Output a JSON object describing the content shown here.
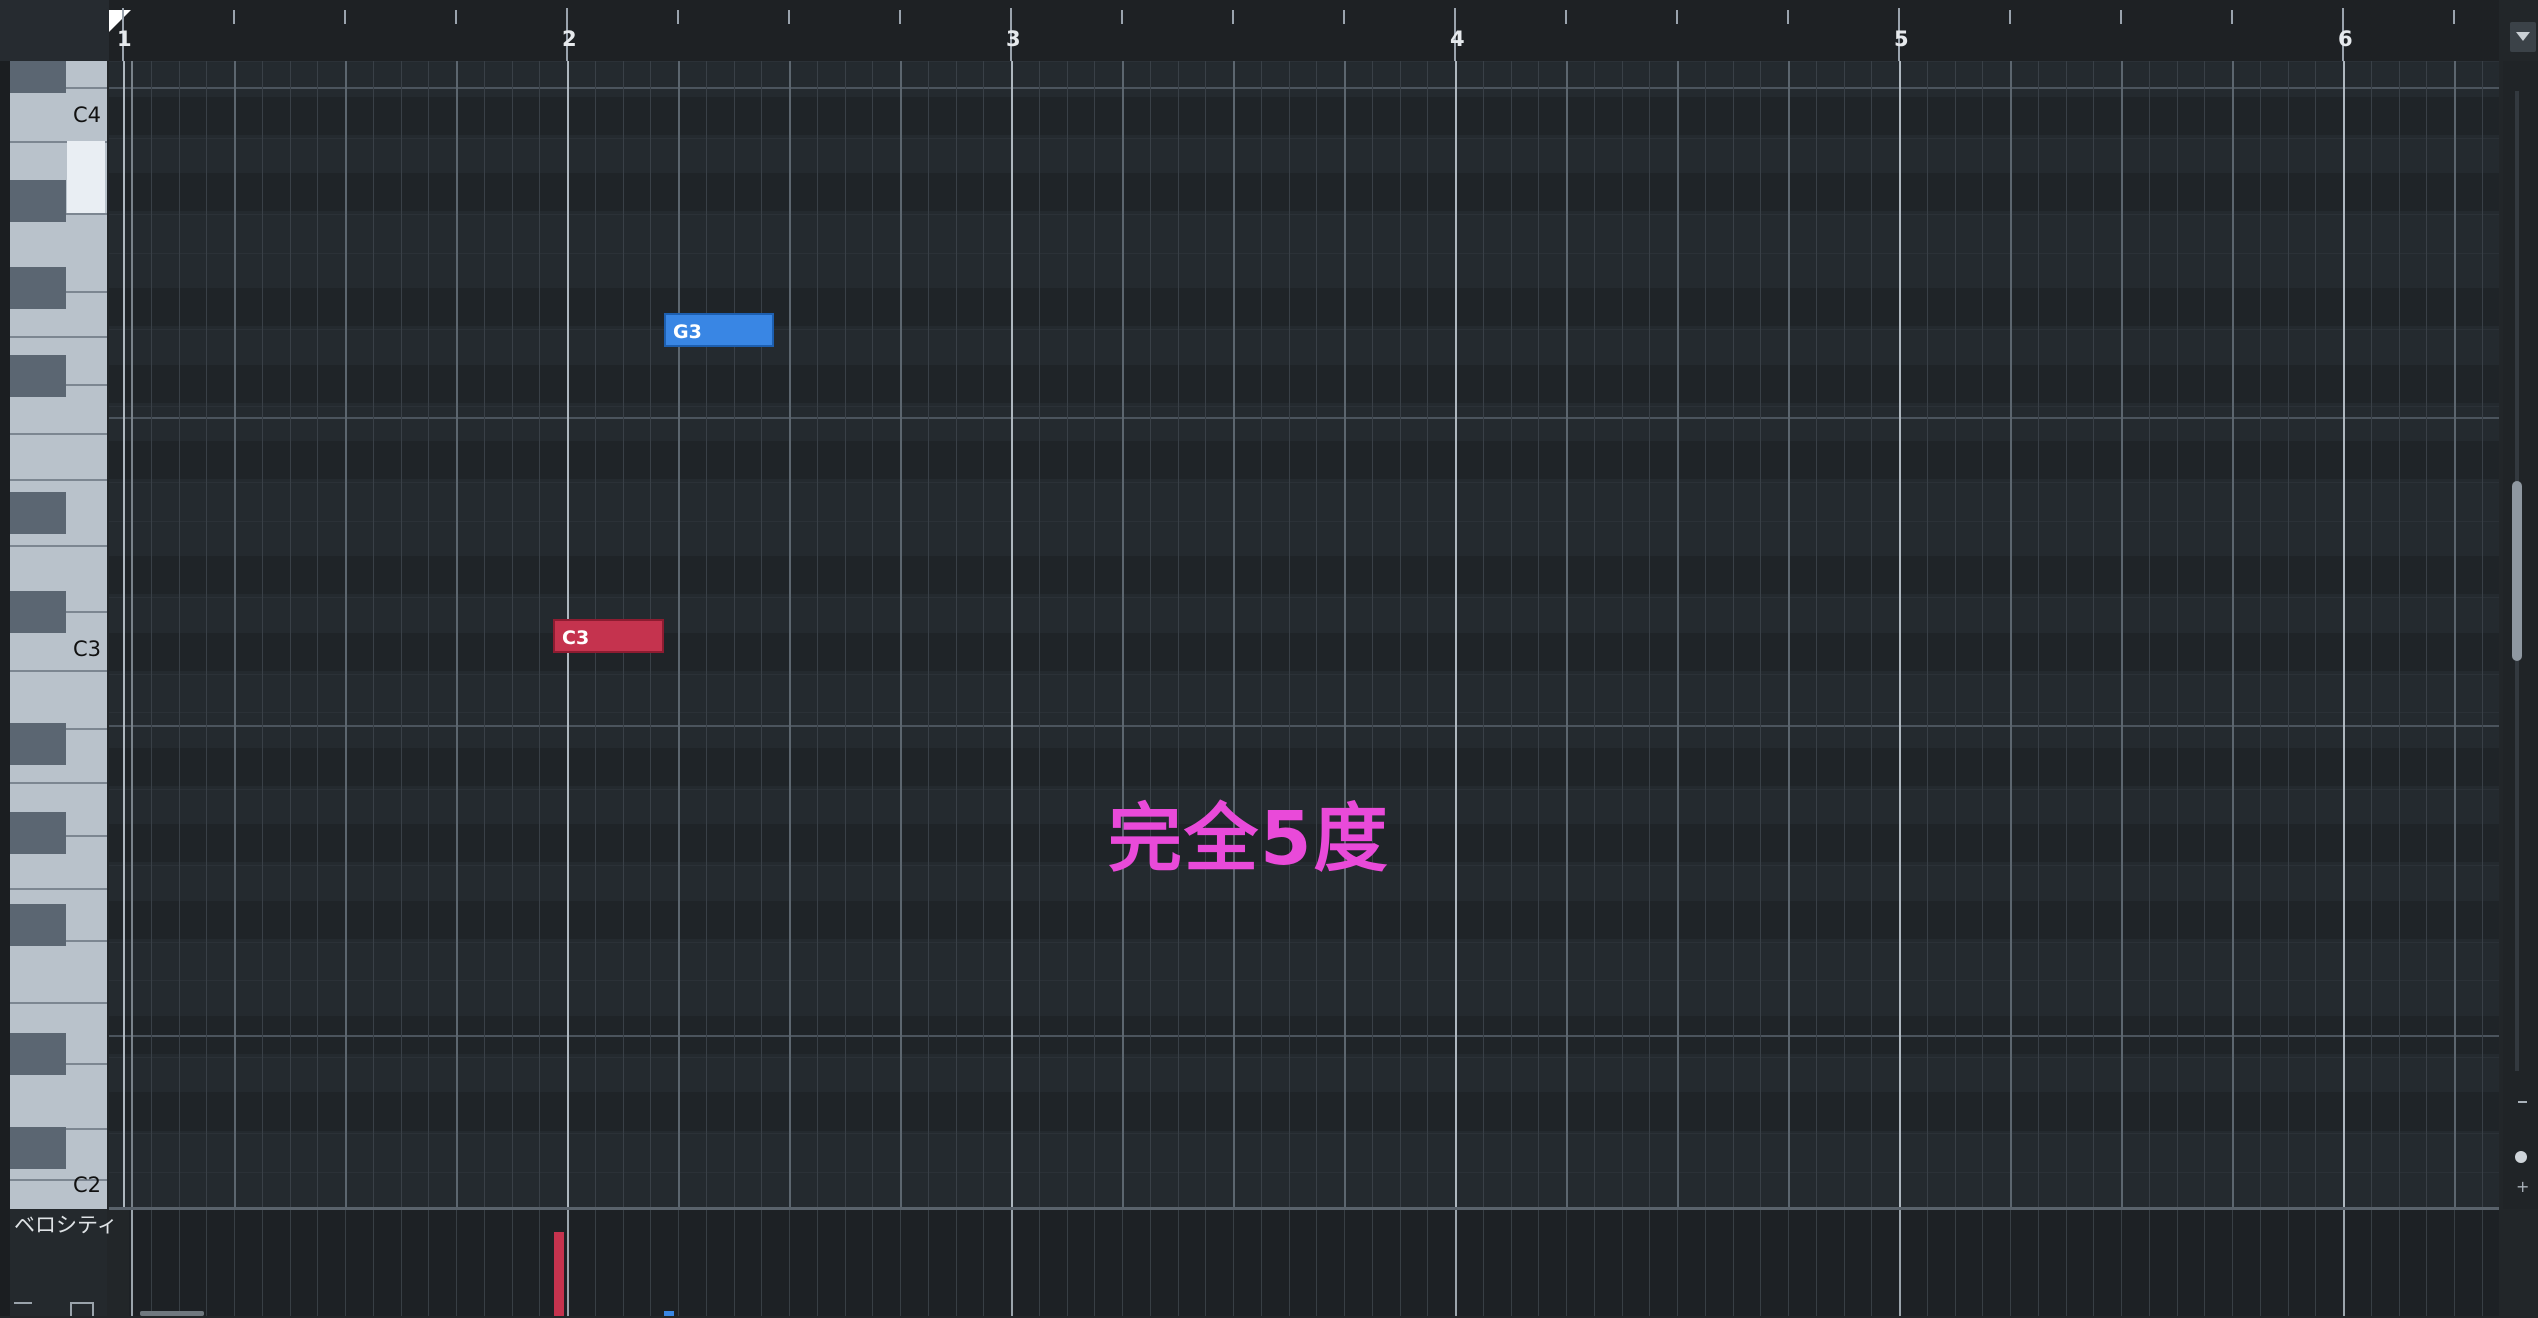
{
  "ruler": {
    "bars": [
      {
        "number": "1"
      },
      {
        "number": "2"
      },
      {
        "number": "3"
      },
      {
        "number": "4"
      },
      {
        "number": "5"
      },
      {
        "number": "6"
      }
    ]
  },
  "keyboard": {
    "labels": {
      "c4": "C4",
      "c3": "C3",
      "c2": "C2"
    },
    "highlighted_key": "B3"
  },
  "notes": [
    {
      "pitch": "G3",
      "label": "G3",
      "start_bar": 2.25,
      "length_beats": 1,
      "color": "#3986e4"
    },
    {
      "pitch": "C3",
      "label": "C3",
      "start_bar": 2.0,
      "length_beats": 1,
      "color": "#c5334e"
    }
  ],
  "annotation": {
    "text": "完全5度",
    "color": "#e94ad9"
  },
  "velocity": {
    "label": "ベロシティ"
  },
  "colors": {
    "grid_bg": "#242a2f",
    "note_blue": "#3986e4",
    "note_red": "#c5334e",
    "accent_magenta": "#e94ad9"
  }
}
